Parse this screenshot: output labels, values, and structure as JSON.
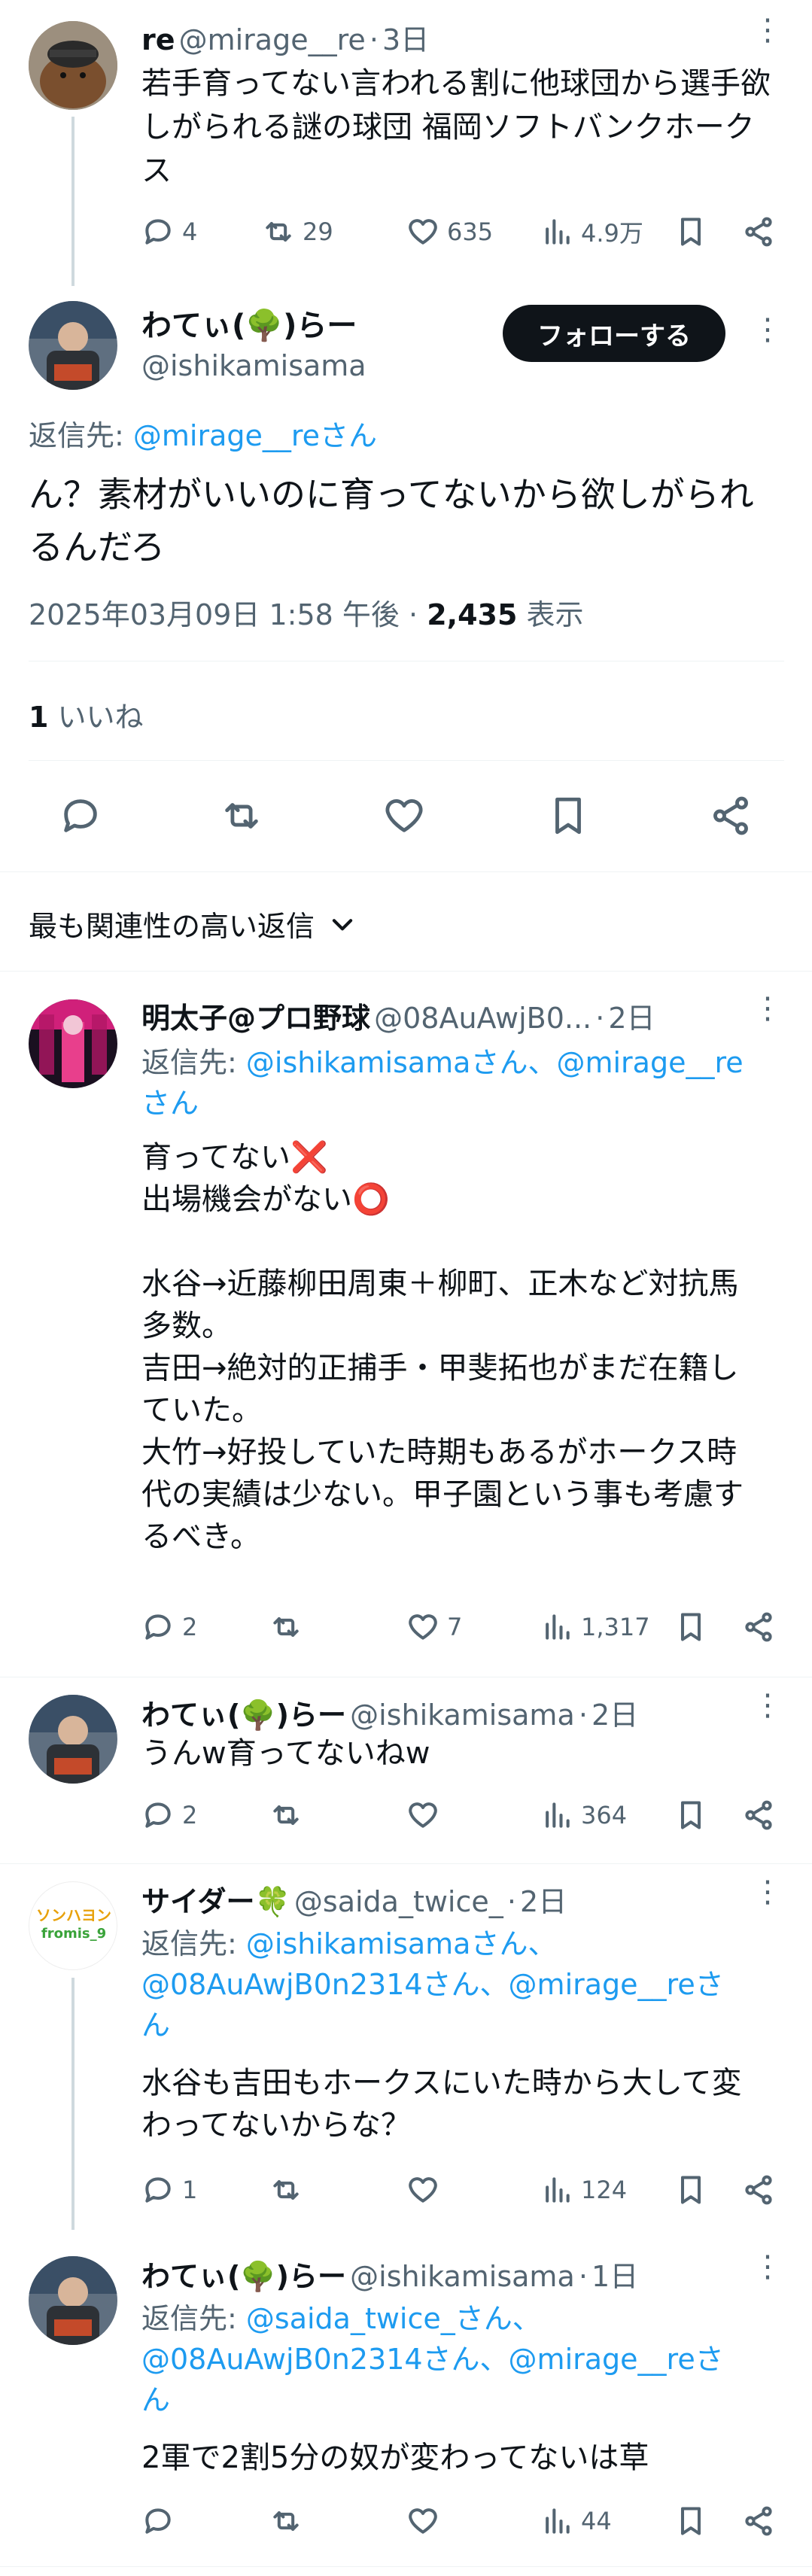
{
  "original": {
    "name": "re",
    "handle": "@mirage__re",
    "time": "3日",
    "text": "若手育ってない言われる割に他球団から選手欲しがられる謎の球団 福岡ソフトバンクホークス",
    "replies": "4",
    "reposts": "29",
    "likes": "635",
    "views": "4.9万"
  },
  "main": {
    "name": "わてぃ(🌳)らー",
    "handle": "@ishikamisama",
    "follow_label": "フォローする",
    "reply_prefix": "返信先: ",
    "reply_to": "@mirage__reさん",
    "text": "ん？素材がいいのに育ってないから欲しがられるんだろ",
    "timestamp": "2025年03月09日 1:58 午後",
    "views_count": "2,435",
    "views_label": "表示",
    "likes_count": "1",
    "likes_label": "いいね"
  },
  "sort": {
    "label": "最も関連性の高い返信"
  },
  "replies": [
    {
      "name": "明太子@プロ野球",
      "handle": "@08AuAwjB0...",
      "time": "2日",
      "reply_prefix": "返信先: ",
      "reply_to_line1": "@ishikamisamaさん、@mirage__re",
      "reply_to_line2": "さん",
      "text": "育ってない❌\n出場機会がない⭕\n\n水谷→近藤柳田周東＋柳町、正木など対抗馬多数。\n吉田→絶対的正捕手・甲斐拓也がまだ在籍していた。\n大竹→好投していた時期もあるがホークス時代の実績は少ない。甲子園という事も考慮するべき。",
      "replies": "2",
      "reposts": "",
      "likes": "7",
      "views": "1,317"
    },
    {
      "name": "わてぃ(🌳)らー",
      "handle": "@ishikamisama",
      "time": "2日",
      "text": "うんw育ってないねw",
      "replies": "2",
      "reposts": "",
      "likes": "",
      "views": "364"
    },
    {
      "name": "サイダー🍀",
      "handle": "@saida_twice_",
      "time": "2日",
      "reply_prefix": "返信先: ",
      "reply_to_line1": "@ishikamisamaさん、",
      "reply_to_line2": "@08AuAwjB0n2314さん、@mirage__reさ",
      "reply_to_line3": "ん",
      "text": "水谷も吉田もホークスにいた時から大して変わってないからな？",
      "replies": "1",
      "reposts": "",
      "likes": "",
      "views": "124",
      "avatar_text_1": "ソンハヨン",
      "avatar_text_2": "fromis_9"
    },
    {
      "name": "わてぃ(🌳)らー",
      "handle": "@ishikamisama",
      "time": "1日",
      "reply_prefix": "返信先: ",
      "reply_to_line1": "@saida_twice_さん、",
      "reply_to_line2": "@08AuAwjB0n2314さん、@mirage__reさ",
      "reply_to_line3": "ん",
      "text": "2軍で2割5分の奴が変わってないは草",
      "replies": "",
      "reposts": "",
      "likes": "",
      "views": "44"
    }
  ],
  "colors": {
    "accent": "#1d9bf0",
    "text": "#0f1419",
    "muted": "#536471",
    "border": "#eff3f4"
  }
}
